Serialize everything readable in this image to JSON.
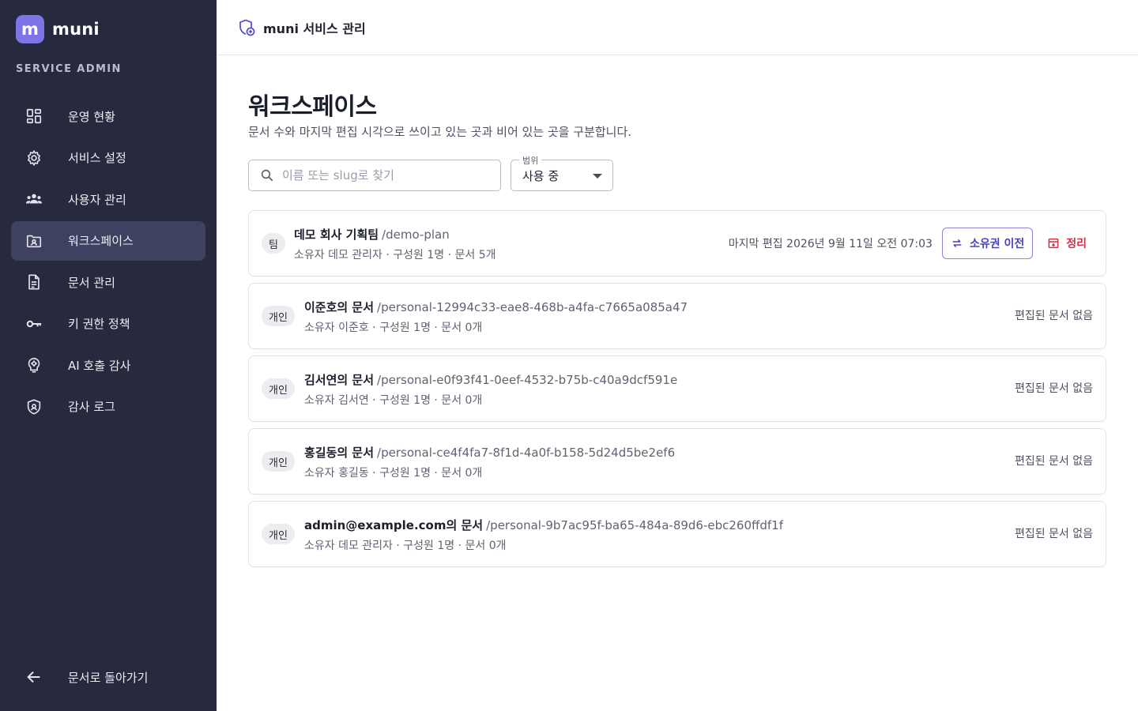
{
  "brand": {
    "logo_letter": "m",
    "name": "muni",
    "subtitle": "SERVICE ADMIN"
  },
  "sidebar": {
    "items": [
      {
        "label": "운영 현황",
        "icon": "dashboard-icon",
        "active": false
      },
      {
        "label": "서비스 설정",
        "icon": "gear-icon",
        "active": false
      },
      {
        "label": "사용자 관리",
        "icon": "users-icon",
        "active": false
      },
      {
        "label": "워크스페이스",
        "icon": "folder-user-icon",
        "active": true
      },
      {
        "label": "문서 관리",
        "icon": "document-icon",
        "active": false
      },
      {
        "label": "키 권한 정책",
        "icon": "key-icon",
        "active": false
      },
      {
        "label": "AI 호출 감사",
        "icon": "ai-brain-icon",
        "active": false
      },
      {
        "label": "감사 로그",
        "icon": "shield-icon",
        "active": false
      }
    ],
    "back": {
      "label": "문서로 돌아가기",
      "icon": "arrow-left-icon"
    }
  },
  "topbar": {
    "title": "muni 서비스 관리",
    "icon": "admin-shield-icon"
  },
  "page": {
    "title": "워크스페이스",
    "description": "문서 수와 마지막 편집 시각으로 쓰이고 있는 곳과 비어 있는 곳을 구분합니다."
  },
  "filters": {
    "search_placeholder": "이름 또는 slug로 찾기",
    "search_value": "",
    "scope_label": "범위",
    "scope_value": "사용 중"
  },
  "workspaces": [
    {
      "badge": "팀",
      "name": "데모 회사 기획팀",
      "slug": "/demo-plan",
      "meta": "소유자 데모 관리자 · 구성원 1명 · 문서 5개",
      "last_edit": "마지막 편집 2026년 9월 11일 오전 07:03",
      "transfer_label": "소유권 이전",
      "clean_label": "정리"
    },
    {
      "badge": "개인",
      "name": "이준호의 문서",
      "slug": "/personal-12994c33-eae8-468b-a4fa-c7665a085a47",
      "meta": "소유자 이준호 · 구성원 1명 · 문서 0개",
      "status": "편집된 문서 없음"
    },
    {
      "badge": "개인",
      "name": "김서연의 문서",
      "slug": "/personal-e0f93f41-0eef-4532-b75b-c40a9dcf591e",
      "meta": "소유자 김서연 · 구성원 1명 · 문서 0개",
      "status": "편집된 문서 없음"
    },
    {
      "badge": "개인",
      "name": "홍길동의 문서",
      "slug": "/personal-ce4f4fa7-8f1d-4a0f-b158-5d24d5be2ef6",
      "meta": "소유자 홍길동 · 구성원 1명 · 문서 0개",
      "status": "편집된 문서 없음"
    },
    {
      "badge": "개인",
      "name": "admin@example.com의 문서",
      "slug": "/personal-9b7ac95f-ba65-484a-89d6-ebc260ffdf1f",
      "meta": "소유자 데모 관리자 · 구성원 1명 · 문서 0개",
      "status": "편집된 문서 없음"
    }
  ],
  "colors": {
    "sidebar_bg": "#272a3f",
    "active_item_bg": "#3e4160",
    "accent": "#7d74e6",
    "danger": "#cf2e45"
  }
}
